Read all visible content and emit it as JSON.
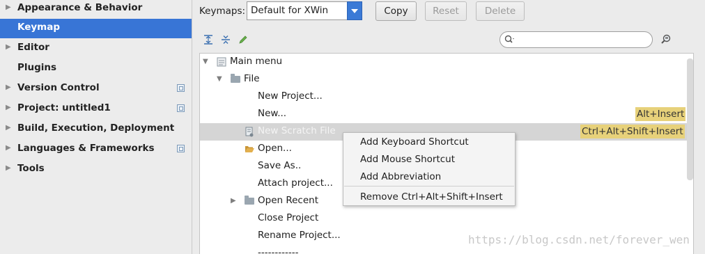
{
  "sidebar": {
    "items": [
      {
        "label": "Appearance & Behavior",
        "expandable": true
      },
      {
        "label": "Keymap",
        "selected": true
      },
      {
        "label": "Editor",
        "expandable": true
      },
      {
        "label": "Plugins"
      },
      {
        "label": "Version Control",
        "expandable": true,
        "project_icon": true
      },
      {
        "label": "Project: untitled1",
        "expandable": true,
        "project_icon": true
      },
      {
        "label": "Build, Execution, Deployment",
        "expandable": true
      },
      {
        "label": "Languages & Frameworks",
        "expandable": true,
        "project_icon": true
      },
      {
        "label": "Tools",
        "expandable": true
      }
    ]
  },
  "toolbar": {
    "keymaps_label": "Keymaps:",
    "keymap_selected": "Default for XWin",
    "copy_label": "Copy",
    "reset_label": "Reset",
    "delete_label": "Delete",
    "search_placeholder": ""
  },
  "tree": {
    "rows": [
      {
        "text": "Main menu",
        "level": 0,
        "expanded": true
      },
      {
        "text": "File",
        "level": 1,
        "expanded": true
      },
      {
        "text": "New Project...",
        "level": 2
      },
      {
        "text": "New...",
        "level": 2,
        "shortcut": "Alt+Insert"
      },
      {
        "text": "New Scratch File",
        "level": 2,
        "shortcut": "Ctrl+Alt+Shift+Insert",
        "selected": true
      },
      {
        "text": "Open...",
        "level": 2
      },
      {
        "text": "Save As..",
        "level": 2
      },
      {
        "text": "Attach project...",
        "level": 2
      },
      {
        "text": "Open Recent",
        "level": 2,
        "collapsed": true
      },
      {
        "text": "Close Project",
        "level": 2
      },
      {
        "text": "Rename Project...",
        "level": 2
      },
      {
        "text": "------------",
        "level": 2
      }
    ]
  },
  "context_menu": {
    "items": [
      "Add Keyboard Shortcut",
      "Add Mouse Shortcut",
      "Add Abbreviation",
      "Remove Ctrl+Alt+Shift+Insert"
    ]
  },
  "watermark": "https://blog.csdn.net/forever_wen",
  "colors": {
    "accent": "#3875d6",
    "shortcut_highlight": "#e7d17a"
  }
}
